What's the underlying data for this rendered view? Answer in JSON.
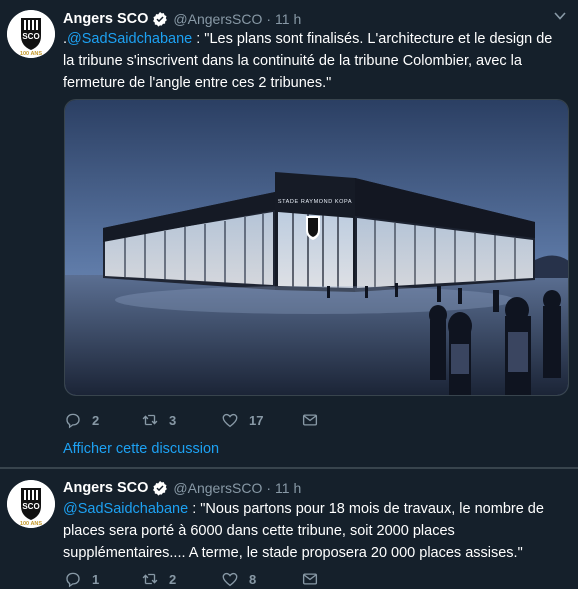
{
  "tweets": [
    {
      "author": {
        "name": "Angers SCO",
        "handle": "@AngersSCO",
        "time": "11 h"
      },
      "text_prefix": ".",
      "mention": "@SadSaidchabane",
      "text": " : \"Les plans sont finalisés. L'architecture et le design de la tribune s'inscrivent dans la continuité de la tribune Colombier, avec la fermeture de l'angle entre ces 2 tribunes.\"",
      "media": {
        "stadium_sign": "STADE RAYMOND KOPA"
      },
      "stats": {
        "replies": "2",
        "retweets": "3",
        "likes": "17"
      },
      "thread_link": "Afficher cette discussion"
    },
    {
      "author": {
        "name": "Angers SCO",
        "handle": "@AngersSCO",
        "time": "11 h"
      },
      "text_prefix": "",
      "mention": "@SadSaidchabane",
      "text": " : \"Nous partons pour 18 mois de travaux, le nombre de places sera porté à 6000 dans cette tribune, soit 2000 places supplémentaires.... A terme, le stade proposera 20 000 places assises.\"",
      "stats": {
        "replies": "1",
        "retweets": "2",
        "likes": "8"
      }
    }
  ],
  "avatar": {
    "club_short": "SCO",
    "anniversary": "100 ANS"
  },
  "colors": {
    "background": "#15202b",
    "accent": "#1da1f2",
    "muted": "#8899a6",
    "divider": "#38444d"
  }
}
